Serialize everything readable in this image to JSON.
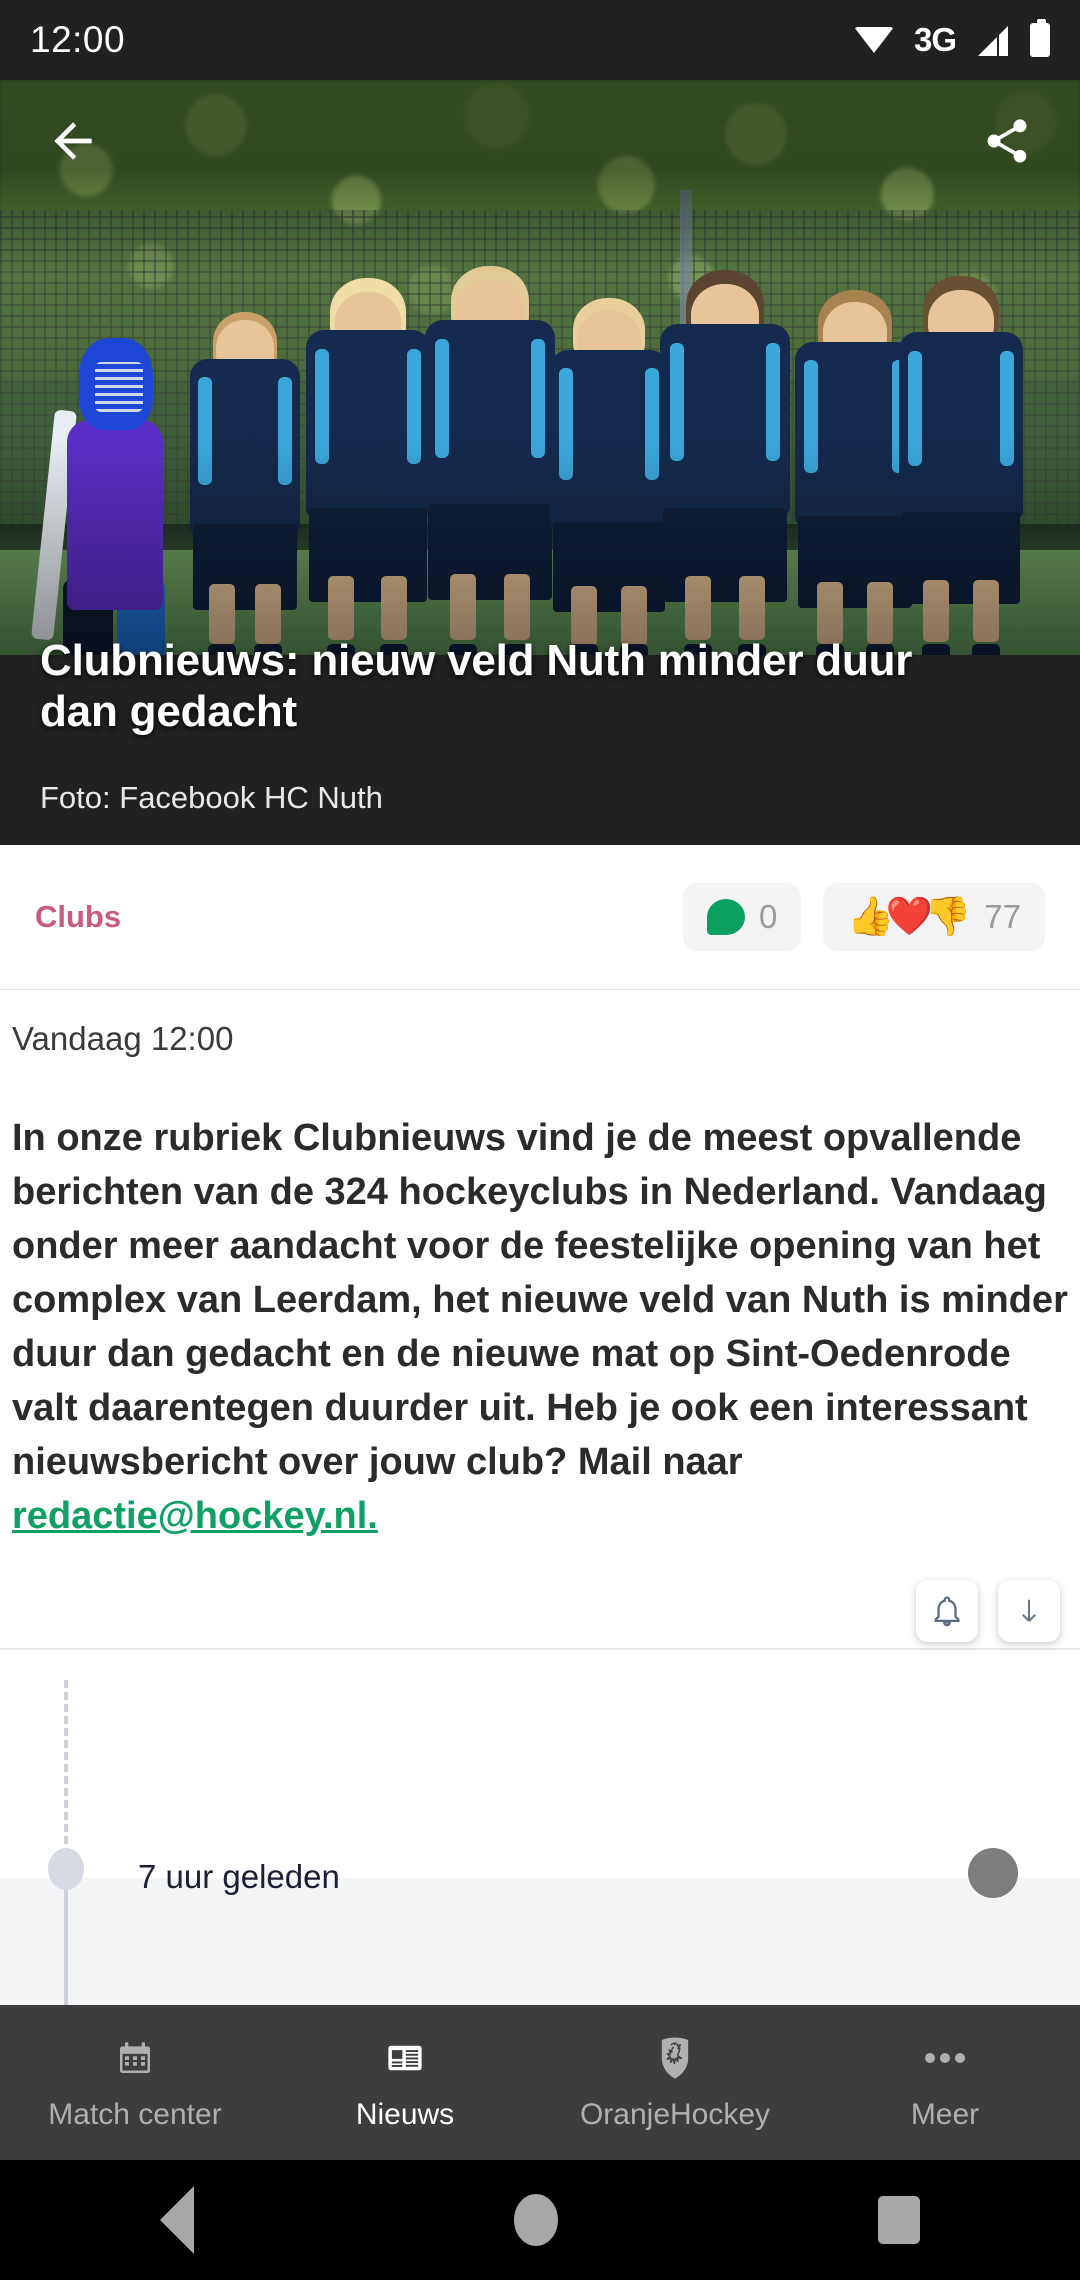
{
  "status_bar": {
    "time": "12:00",
    "network_label": "3G",
    "icons": [
      "wifi-icon",
      "signal-icon",
      "battery-icon"
    ]
  },
  "hero": {
    "back_icon": "back-arrow-icon",
    "share_icon": "share-icon",
    "headline": "Clubnieuws: nieuw veld Nuth minder duur dan gedacht",
    "photo_credit": "Foto: Facebook HC Nuth"
  },
  "meta": {
    "category": "Clubs",
    "comment_count": "0",
    "reaction_count": "77",
    "reaction_emojis": "👍❤️👎",
    "category_color": "#c85b7f",
    "comment_icon_color": "#0aa05f"
  },
  "article": {
    "timestamp": "Vandaag 12:00",
    "body": "In onze rubriek Clubnieuws vind je de meest opvallende berichten van de 324 hockeyclubs in Nederland. Vandaag onder meer aandacht voor de feestelijke opening van het complex van Leerdam, het nieuwe veld van Nuth is minder duur dan gedacht en de nieuwe mat op Sint-Oedenrode valt daarentegen duurder uit. Heb je ook een interessant nieuwsbericht over jouw club? Mail naar ",
    "email_link": "redactie@hockey.nl.",
    "link_color": "#11a064"
  },
  "floating_actions": [
    {
      "name": "notification-bell-button",
      "icon": "bell-icon"
    },
    {
      "name": "scroll-down-button",
      "icon": "arrow-down-icon"
    }
  ],
  "timeline": {
    "label": "7 uur geleden"
  },
  "bottom_nav": {
    "items": [
      {
        "label": "Match center",
        "icon": "calendar-icon",
        "active": false
      },
      {
        "label": "Nieuws",
        "icon": "newspaper-icon",
        "active": true
      },
      {
        "label": "OranjeHockey",
        "icon": "lion-shield-icon",
        "active": false
      },
      {
        "label": "Meer",
        "icon": "more-dots-icon",
        "active": false
      }
    ]
  },
  "android_nav": {
    "back": "back-triangle-icon",
    "home": "home-circle-icon",
    "recents": "recents-square-icon"
  }
}
